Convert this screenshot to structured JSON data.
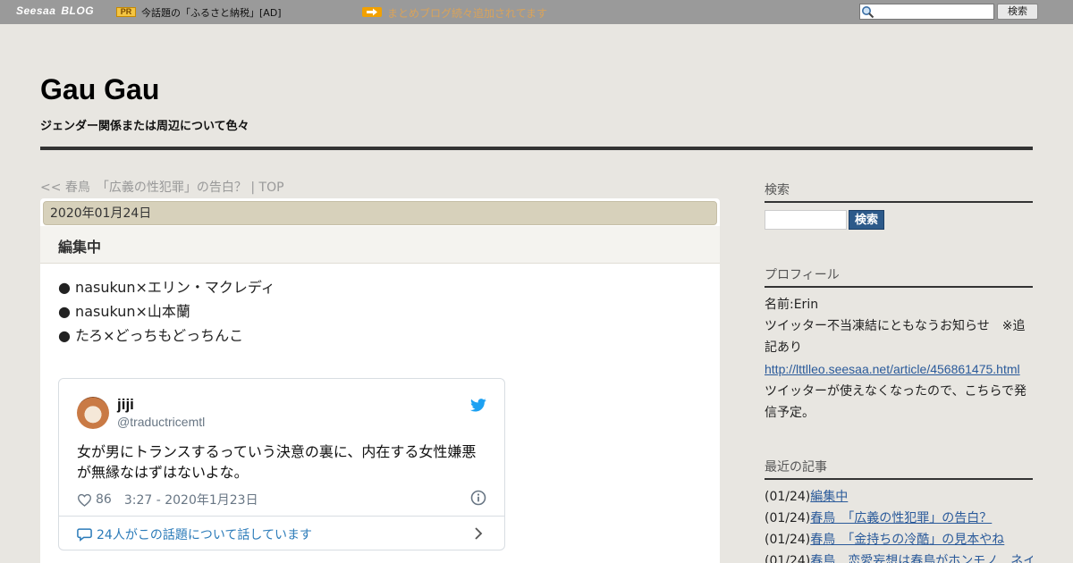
{
  "topbar": {
    "logo_primary": "Seesaa",
    "logo_secondary": "BLOG",
    "pr_badge": "PR",
    "pr_text": "今話題の「ふるさと納税」[AD]",
    "notice": "まとめブログ続々追加されてます",
    "search_button": "検索"
  },
  "header": {
    "title": "Gau Gau",
    "description": "ジェンダー関係または周辺について色々"
  },
  "breadcrumb": {
    "prev": "<< 春鳥　「広義の性犯罪」の告白？",
    "separator": " | ",
    "top": "TOP"
  },
  "post": {
    "date": "2020年01月24日",
    "title": "編集中",
    "items": [
      "● nasukun×エリン・マクレディ",
      "● nasukun×山本蘭",
      "● たろ×どっちもどっちんこ"
    ]
  },
  "tweet": {
    "name": "jiji",
    "handle": "@traductricemtl",
    "text": "女が男にトランスするっていう決意の裏に、内在する女性嫌悪が無縁なはずはないよな。",
    "likes": "86",
    "time": "3:27 - 2020年1月23日",
    "talk": "24人がこの話題について話しています",
    "brand_color": "#1da1f2"
  },
  "sidebar": {
    "search_heading": "検索",
    "search_button": "検索",
    "profile_heading": "プロフィール",
    "profile_name": "名前:Erin",
    "profile_notice": "ツイッター不当凍結にともなうお知らせ　※追記あり",
    "profile_link": "http://lttlleo.seesaa.net/article/456861475.html",
    "profile_note": "ツイッターが使えなくなったので、こちらで発信予定。",
    "recent_heading": "最近の記事",
    "recent": [
      {
        "date": "(01/24)",
        "title": "編集中"
      },
      {
        "date": "(01/24)",
        "title": "春鳥　「広義の性犯罪」の告白？"
      },
      {
        "date": "(01/24)",
        "title": "春鳥　「金持ちの冷酷」の見本やね"
      },
      {
        "date": "(01/24)",
        "title": "春鳥　恋愛妄想は春鳥がホンモノ　ネイ"
      }
    ]
  }
}
